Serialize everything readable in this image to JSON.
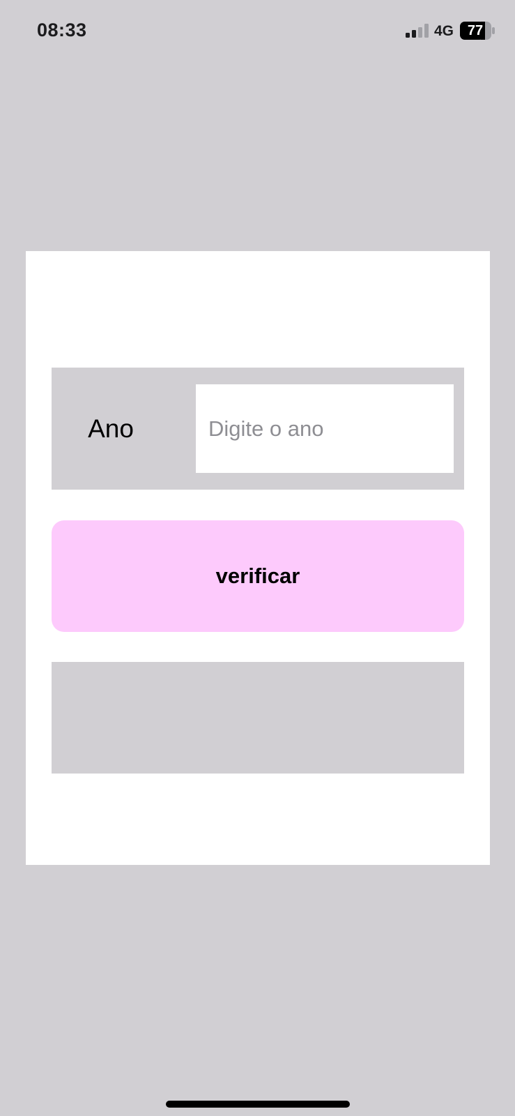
{
  "status_bar": {
    "time": "08:33",
    "network": "4G",
    "battery": "77",
    "icons": [
      "signal-icon",
      "battery-icon"
    ]
  },
  "form": {
    "year_label": "Ano",
    "year_input": {
      "value": "",
      "placeholder": "Digite o ano"
    },
    "verify_label": "verificar",
    "result_text": ""
  },
  "colors": {
    "background": "#d1cfd3",
    "card": "#ffffff",
    "button": "#fdcafc",
    "placeholder": "#8e8e93"
  }
}
